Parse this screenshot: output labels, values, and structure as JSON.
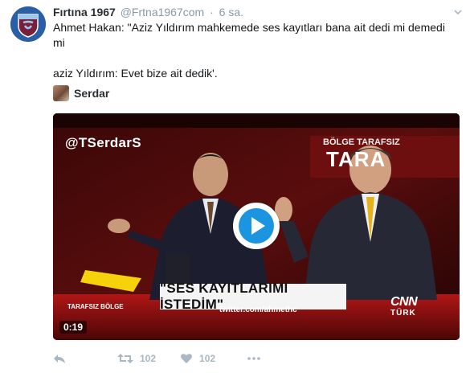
{
  "tweet": {
    "author": {
      "fullname": "Fırtına 1967",
      "handle": "@Frtna1967com",
      "separator": "·",
      "time": "6 sa."
    },
    "text": {
      "line1": "Ahmet Hakan: \"Aziz Yıldırım mahkemede ses kayıtları bana ait dedi mi demedi mi",
      "line2": "aziz Yıldırım: Evet bize ait dedik'."
    },
    "quoted_author": "Serdar"
  },
  "media": {
    "watermark": "@TSerdarS",
    "caption": "\"SES KAYITLARIMI İSTEDİM\"",
    "subline": "twitter.com/ahmethc",
    "banner_small": "BÖLGE  TARAFSIZ",
    "banner_large": "TARA",
    "show_tag": "TARAFSIZ BÖLGE",
    "channel_top": "CNN",
    "channel_bottom": "TÜRK",
    "duration": "0:19"
  },
  "actions": {
    "retweet_count": "102",
    "like_count": "102"
  },
  "icons": {
    "avatar": "trabzonspor-crest-icon",
    "menu": "chevron-down-icon",
    "play": "play-icon",
    "reply": "reply-icon",
    "retweet": "retweet-icon",
    "like": "heart-icon",
    "more": "more-dots-icon"
  },
  "colors": {
    "text": "#14171a",
    "muted": "#8899a6",
    "action": "#aab8c2",
    "play_accent": "#1b95e0",
    "avatar_blue": "#2a5fa6"
  }
}
